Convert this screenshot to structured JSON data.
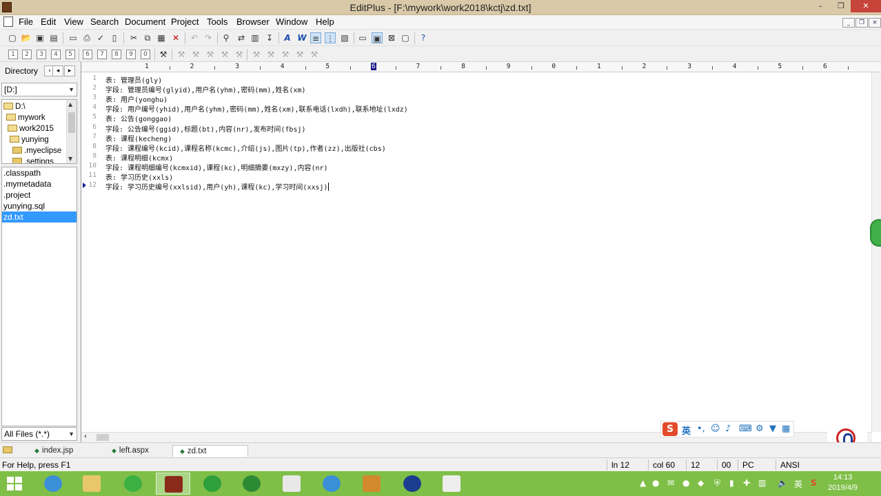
{
  "window": {
    "title": "EditPlus - [F:\\mywork\\work2018\\kctj\\zd.txt]",
    "minimize": "–",
    "maximize": "❐",
    "close": "✕"
  },
  "menu": [
    "File",
    "Edit",
    "View",
    "Search",
    "Document",
    "Project",
    "Tools",
    "Browser",
    "Window",
    "Help"
  ],
  "mdi": {
    "minimize": "_",
    "restore": "❐",
    "close": "×"
  },
  "toolbar2_numbers": [
    "1",
    "2",
    "3",
    "4",
    "5",
    "6",
    "7",
    "8",
    "9",
    "0"
  ],
  "left": {
    "tab_label": "Directory",
    "drive": "[D:]",
    "tree": [
      {
        "label": "D:\\",
        "indent": 0
      },
      {
        "label": "mywork",
        "indent": 1
      },
      {
        "label": "work2015",
        "indent": 1
      },
      {
        "label": "yunying",
        "indent": 2
      },
      {
        "label": ".myeclipse",
        "indent": 3
      },
      {
        "label": ".settings",
        "indent": 3
      }
    ],
    "files": [
      ".classpath",
      ".mymetadata",
      ".project",
      "yunying.sql",
      "zd.txt"
    ],
    "selected_file": "zd.txt",
    "filter": "All Files (*.*)"
  },
  "ruler": {
    "labels": [
      "1",
      "2",
      "3",
      "4",
      "5",
      "6",
      "7",
      "8",
      "9",
      "0",
      "1",
      "2",
      "3",
      "4",
      "5",
      "6"
    ],
    "current_col_label": "6"
  },
  "editor": {
    "lines": [
      "表: 管理员(gly)",
      "字段: 管理员编号(glyid),用户名(yhm),密码(mm),姓名(xm)",
      "表: 用户(yonghu)",
      "字段: 用户编号(yhid),用户名(yhm),密码(mm),姓名(xm),联系电话(lxdh),联系地址(lxdz)",
      "表: 公告(gonggao)",
      "字段: 公告编号(ggid),标题(bt),内容(nr),发布时间(fbsj)",
      "表: 课程(kecheng)",
      "字段: 课程编号(kcid),课程名称(kcmc),介绍(js),图片(tp),作者(zz),出版社(cbs)",
      "表: 课程明细(kcmx)",
      "字段: 课程明细编号(kcmxid),课程(kc),明细摘要(mxzy),内容(nr)",
      "表: 学习历史(xxls)",
      "字段: 学习历史编号(xxlsid),用户(yh),课程(kc),学习时间(xxsj)"
    ],
    "current_line": 12
  },
  "ime": {
    "lang": "英"
  },
  "tabs": [
    "index.jsp",
    "left.aspx",
    "zd.txt"
  ],
  "active_tab": "zd.txt",
  "status": {
    "help": "For Help, press F1",
    "line": "ln 12",
    "col": "col 60",
    "num": "12",
    "code": "00",
    "mode": "PC",
    "encoding": "ANSI"
  },
  "taskbar": {
    "time": "14:13",
    "date": "2019/4/9",
    "tray_lang": "英"
  },
  "colors": {
    "taskbar": "#7fbf48",
    "titlebar": "#d9c9a8",
    "selection": "#3399ff",
    "marker": "#1a1a8c"
  }
}
